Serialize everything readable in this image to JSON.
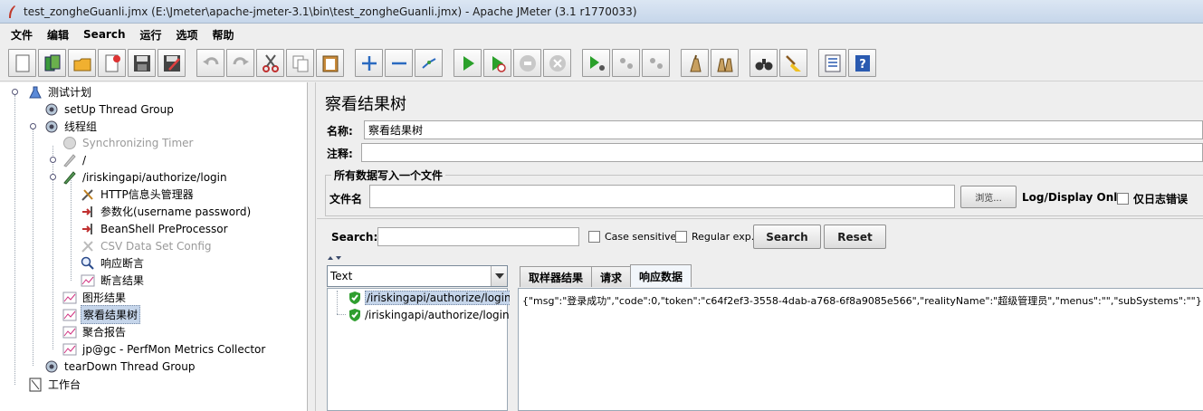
{
  "window": {
    "title": "test_zongheGuanli.jmx (E:\\Jmeter\\apache-jmeter-3.1\\bin\\test_zongheGuanli.jmx) - Apache JMeter (3.1 r1770033)"
  },
  "menu": [
    "文件",
    "编辑",
    "Search",
    "运行",
    "选项",
    "帮助"
  ],
  "toolbar": {
    "buttons": [
      "new-icon",
      "templates-icon",
      "open-icon",
      "close-icon",
      "save-icon",
      "save-as-icon",
      "undo-icon",
      "redo-icon",
      "cut-icon",
      "copy-icon",
      "paste-icon",
      "expand-icon",
      "collapse-icon",
      "toggle-icon",
      "start-icon",
      "start-no-pause-icon",
      "stop-icon",
      "shutdown-icon",
      "remote-start-icon",
      "remote-stop-icon",
      "remote-shutdown-icon",
      "clear-icon",
      "clear-all-icon",
      "search-icon",
      "reset-search-icon",
      "function-helper-icon",
      "help-icon"
    ]
  },
  "tree": {
    "items": [
      {
        "label": "测试计划",
        "icon": "test-plan-icon"
      },
      {
        "label": "setUp Thread Group",
        "icon": "thread-group-icon"
      },
      {
        "label": "线程组",
        "icon": "thread-group-icon"
      },
      {
        "label": "Synchronizing Timer",
        "icon": "timer-icon"
      },
      {
        "label": "/",
        "icon": "sampler-icon"
      },
      {
        "label": "/iriskingapi/authorize/login",
        "icon": "sampler-icon"
      },
      {
        "label": "HTTP信息头管理器",
        "icon": "header-manager-icon"
      },
      {
        "label": "参数化(username password)",
        "icon": "preprocessor-icon"
      },
      {
        "label": "BeanShell PreProcessor",
        "icon": "preprocessor-icon"
      },
      {
        "label": "CSV Data Set Config",
        "icon": "config-icon"
      },
      {
        "label": "响应断言",
        "icon": "assertion-icon"
      },
      {
        "label": "断言结果",
        "icon": "listener-icon"
      },
      {
        "label": "图形结果",
        "icon": "listener-icon"
      },
      {
        "label": "察看结果树",
        "icon": "listener-icon"
      },
      {
        "label": "聚合报告",
        "icon": "listener-icon"
      },
      {
        "label": "jp@gc - PerfMon Metrics Collector",
        "icon": "listener-icon"
      },
      {
        "label": "tearDown Thread Group",
        "icon": "thread-group-icon"
      },
      {
        "label": "工作台",
        "icon": "workbench-icon"
      }
    ]
  },
  "panel": {
    "title": "察看结果树",
    "name_label": "名称:",
    "name_value": "察看结果树",
    "comment_label": "注释:",
    "comment_value": "",
    "file_group_title": "所有数据写入一个文件",
    "filename_label": "文件名",
    "filename_value": "",
    "browse_label": "浏览...",
    "log_display_label": "Log/Display Only:",
    "errors_only_label": "仅日志错误",
    "search_label": "Search:",
    "search_value": "",
    "case_sensitive_label": "Case sensitive",
    "regular_exp_label": "Regular exp.",
    "search_button": "Search",
    "reset_button": "Reset",
    "renderer_value": "Text",
    "results": [
      "/iriskingapi/authorize/login",
      "/iriskingapi/authorize/login"
    ],
    "tabs": [
      "取样器结果",
      "请求",
      "响应数据"
    ],
    "active_tab": "响应数据",
    "response_body": "{\"msg\":\"登录成功\",\"code\":0,\"token\":\"c64f2ef3-3558-4dab-a768-6f8a9085e566\",\"realityName\":\"超级管理员\",\"menus\":\"\",\"subSystems\":\"\"}"
  },
  "colors": {
    "selection": "#c5d5ea",
    "success_green": "#2f9e2f"
  }
}
